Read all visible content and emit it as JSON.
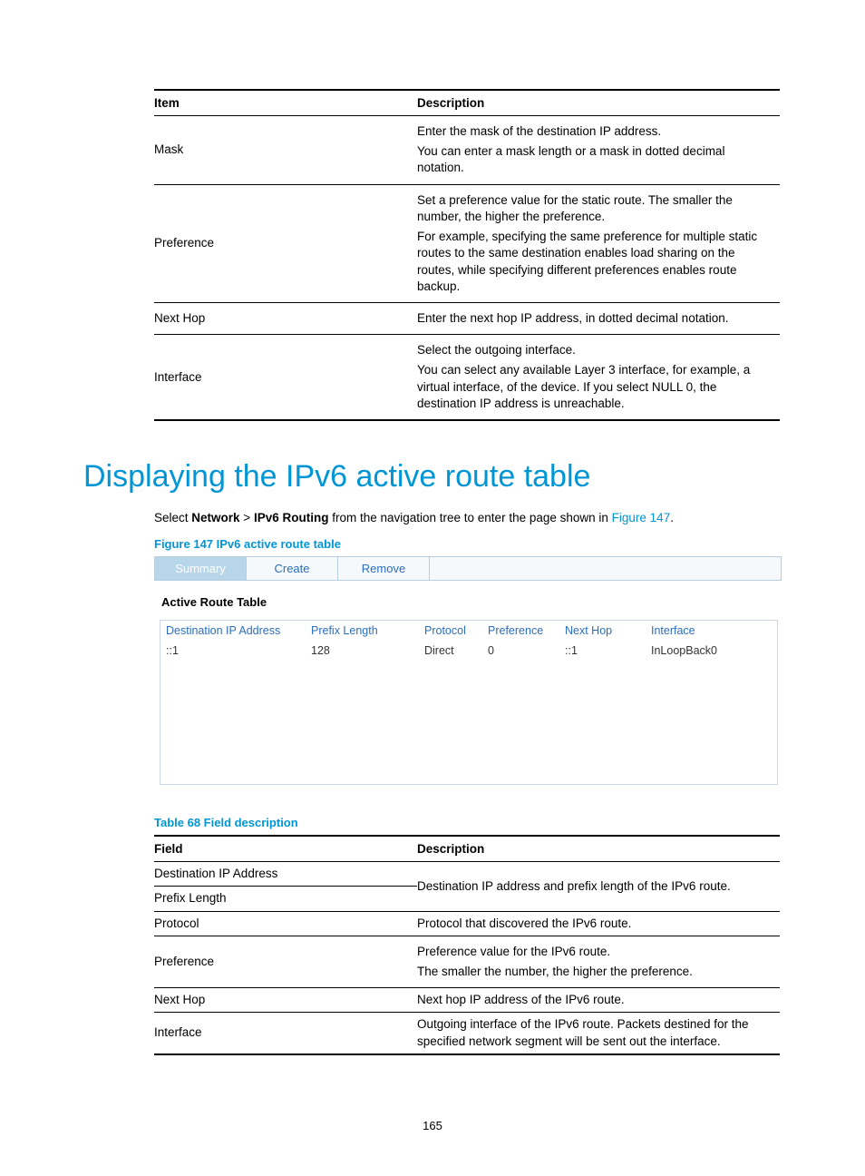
{
  "table1": {
    "headers": [
      "Item",
      "Description"
    ],
    "rows": [
      {
        "label": "Mask",
        "desc": [
          "Enter the mask of the destination IP address.",
          "You can enter a mask length or a mask in dotted decimal notation."
        ]
      },
      {
        "label": "Preference",
        "desc": [
          "Set a preference value for the static route. The smaller the number, the higher the preference.",
          "For example, specifying the same preference for multiple static routes to the same destination enables load sharing on the routes, while specifying different preferences enables route backup."
        ]
      },
      {
        "label": "Next Hop",
        "desc": [
          "Enter the next hop IP address, in dotted decimal notation."
        ]
      },
      {
        "label": "Interface",
        "desc": [
          "Select the outgoing interface.",
          "You can select any available Layer 3 interface, for example, a virtual interface, of the device. If you select NULL 0, the destination IP address is unreachable."
        ]
      }
    ]
  },
  "heading": "Displaying the IPv6 active route table",
  "instruction": {
    "pre": "Select ",
    "b1": "Network",
    "gt": " > ",
    "b2": "IPv6 Routing",
    "post": " from the navigation tree to enter the page shown in ",
    "link": "Figure 147",
    "end": "."
  },
  "figure_caption": "Figure 147 IPv6 active route table",
  "tabs": {
    "active": "Summary",
    "others": [
      "Create",
      "Remove"
    ]
  },
  "screenshot": {
    "title": "Active Route Table",
    "headers": [
      "Destination IP Address",
      "Prefix Length",
      "Protocol",
      "Preference",
      "Next Hop",
      "Interface"
    ],
    "row": {
      "dest": "::1",
      "prefix": "128",
      "proto": "Direct",
      "pref": "0",
      "next": "::1",
      "iface": "InLoopBack0"
    }
  },
  "table2_caption": "Table 68 Field description",
  "table2": {
    "headers": [
      "Field",
      "Description"
    ],
    "rows": [
      {
        "label": "Destination IP Address",
        "desc_shared_top": true
      },
      {
        "label": "Prefix Length",
        "desc": "Destination IP address and prefix length of the IPv6 route."
      },
      {
        "label": "Protocol",
        "desc": "Protocol that discovered the IPv6 route."
      },
      {
        "label": "Preference",
        "desc": [
          "Preference value for the IPv6 route.",
          "The smaller the number, the higher the preference."
        ]
      },
      {
        "label": "Next Hop",
        "desc": "Next hop IP address of the IPv6 route."
      },
      {
        "label": "Interface",
        "desc": "Outgoing interface of the IPv6 route. Packets destined for the specified network segment will be sent out the interface."
      }
    ]
  },
  "page_number": "165"
}
